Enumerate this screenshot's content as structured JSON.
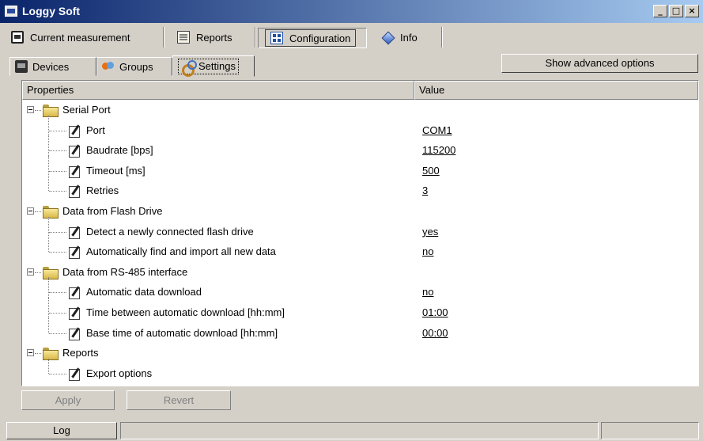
{
  "window": {
    "title": "Loggy Soft",
    "minimize_glyph": "_",
    "maximize_glyph": "□",
    "close_glyph": "×"
  },
  "main_tabs": [
    {
      "label": "Current measurement",
      "icon": "monitor-icon",
      "active": false
    },
    {
      "label": "Reports",
      "icon": "report-icon",
      "active": false
    },
    {
      "label": "Configuration",
      "icon": "configuration-icon",
      "active": true
    },
    {
      "label": "Info",
      "icon": "info-icon",
      "active": false
    }
  ],
  "sub_tabs": [
    {
      "label": "Devices",
      "icon": "device-icon",
      "active": false
    },
    {
      "label": "Groups",
      "icon": "groups-icon",
      "active": false
    },
    {
      "label": "Settings",
      "icon": "settings-icon",
      "active": true
    }
  ],
  "advanced_button": "Show advanced options",
  "grid": {
    "columns": [
      "Properties",
      "Value"
    ],
    "groups": [
      {
        "label": "Serial Port",
        "items": [
          {
            "label": "Port",
            "value": "COM1"
          },
          {
            "label": "Baudrate [bps]",
            "value": "115200"
          },
          {
            "label": "Timeout [ms]",
            "value": "500"
          },
          {
            "label": "Retries",
            "value": "3"
          }
        ]
      },
      {
        "label": "Data from Flash Drive",
        "items": [
          {
            "label": "Detect a newly connected flash drive",
            "value": "yes"
          },
          {
            "label": "Automatically find and import all new data",
            "value": "no"
          }
        ]
      },
      {
        "label": "Data from RS-485 interface",
        "items": [
          {
            "label": "Automatic data download",
            "value": "no"
          },
          {
            "label": "Time between automatic download [hh:mm]",
            "value": "01:00"
          },
          {
            "label": "Base time of automatic download [hh:mm]",
            "value": "00:00"
          }
        ]
      },
      {
        "label": "Reports",
        "items": [
          {
            "label": "Export options",
            "value": ""
          }
        ]
      }
    ]
  },
  "buttons": {
    "apply": "Apply",
    "revert": "Revert"
  },
  "statusbar": {
    "log": "Log"
  },
  "colors": {
    "titlebar_start": "#0a246a",
    "titlebar_end": "#a6caf0",
    "face": "#d4d0c8",
    "disabled_text": "#808080"
  }
}
